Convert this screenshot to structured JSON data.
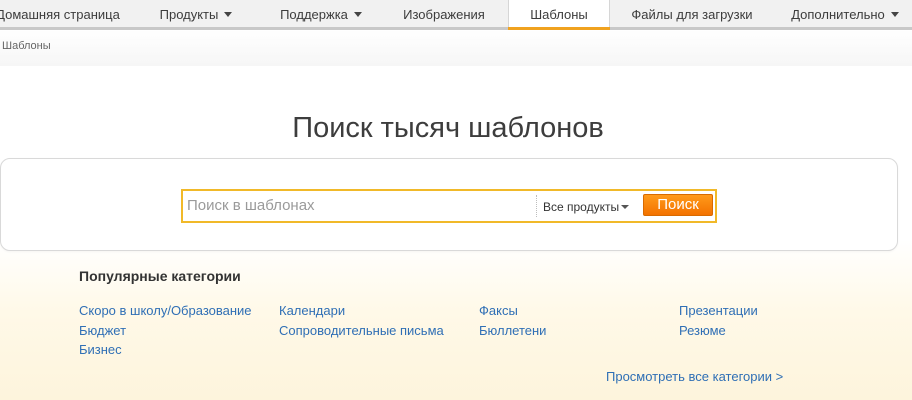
{
  "nav": {
    "items": [
      {
        "label": "Домашняя страница",
        "has_dropdown": false,
        "active": false
      },
      {
        "label": "Продукты",
        "has_dropdown": true,
        "active": false
      },
      {
        "label": "Поддержка",
        "has_dropdown": true,
        "active": false
      },
      {
        "label": "Изображения",
        "has_dropdown": false,
        "active": false
      },
      {
        "label": "Шаблоны",
        "has_dropdown": false,
        "active": true
      },
      {
        "label": "Файлы для загрузки",
        "has_dropdown": false,
        "active": false
      },
      {
        "label": "Дополнительно",
        "has_dropdown": true,
        "active": false
      }
    ],
    "active_accent_color": "#f0a21f"
  },
  "breadcrumb": {
    "text": "Шаблоны"
  },
  "hero": {
    "title": "Поиск тысяч шаблонов"
  },
  "search": {
    "placeholder": "Поиск в шаблонах",
    "value": "",
    "product_filter": "Все продукты",
    "button_label": "Поиск",
    "border_color": "#f1b929",
    "button_color": "#f37200"
  },
  "categories": {
    "heading": "Популярные категории",
    "columns": [
      [
        "Скоро в школу/Образование",
        "Бюджет",
        "Бизнес"
      ],
      [
        "Календари",
        "Сопроводительные письма"
      ],
      [
        "Факсы",
        "Бюллетени"
      ],
      [
        "Презентации",
        "Резюме"
      ]
    ],
    "view_all_label": "Просмотреть все категории >",
    "link_color": "#2f6fb5"
  }
}
